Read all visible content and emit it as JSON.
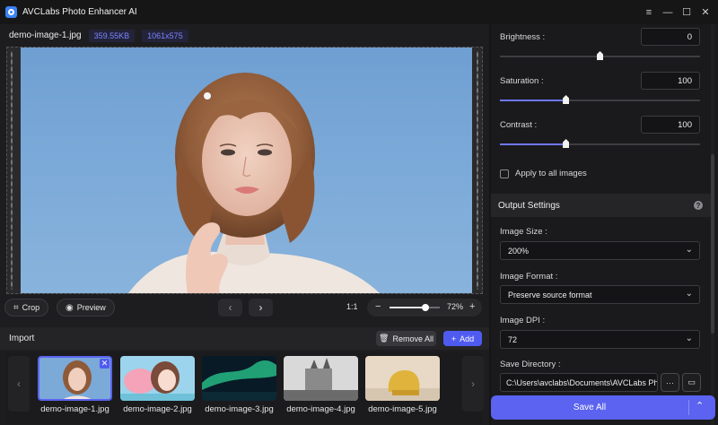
{
  "app": {
    "title": "AVCLabs Photo Enhancer AI"
  },
  "window": {
    "minimize_icon": "menu-icon",
    "controls": [
      "minimize",
      "maximize",
      "close"
    ]
  },
  "file": {
    "name": "demo-image-1.jpg",
    "size": "359.55KB",
    "dimensions": "1061x575"
  },
  "toolbar": {
    "crop_label": "Crop",
    "preview_label": "Preview",
    "ratio_label": "1:1",
    "zoom_value": "72%",
    "zoom_level": 0.72
  },
  "import": {
    "title": "Import",
    "remove_all_label": "Remove All",
    "add_label": "Add",
    "thumbnails": [
      {
        "label": "demo-image-1.jpg",
        "selected": true
      },
      {
        "label": "demo-image-2.jpg",
        "selected": false
      },
      {
        "label": "demo-image-3.jpg",
        "selected": false
      },
      {
        "label": "demo-image-4.jpg",
        "selected": false
      },
      {
        "label": "demo-image-5.jpg",
        "selected": false
      }
    ]
  },
  "adjust": {
    "brightness_label": "Brightness :",
    "brightness_value": "0",
    "brightness_level": 0.5,
    "saturation_label": "Saturation :",
    "saturation_value": "100",
    "saturation_level": 0.33,
    "contrast_label": "Contrast :",
    "contrast_value": "100",
    "contrast_level": 0.33,
    "apply_all_label": "Apply to all images"
  },
  "output": {
    "title": "Output Settings",
    "help_icon": "?",
    "image_size_label": "Image Size :",
    "image_size_value": "200%",
    "image_format_label": "Image Format :",
    "image_format_value": "Preserve source format",
    "image_dpi_label": "Image DPI :",
    "image_dpi_value": "72",
    "save_dir_label": "Save Directory :",
    "save_dir_value": "C:\\Users\\avclabs\\Documents\\AVCLabs Photo Enhancer AI",
    "more_label": "···",
    "save_all_label": "Save All"
  },
  "colors": {
    "accent": "#5b63f0",
    "badge_text": "#7c82ff",
    "sky": "#7ba9d8"
  }
}
